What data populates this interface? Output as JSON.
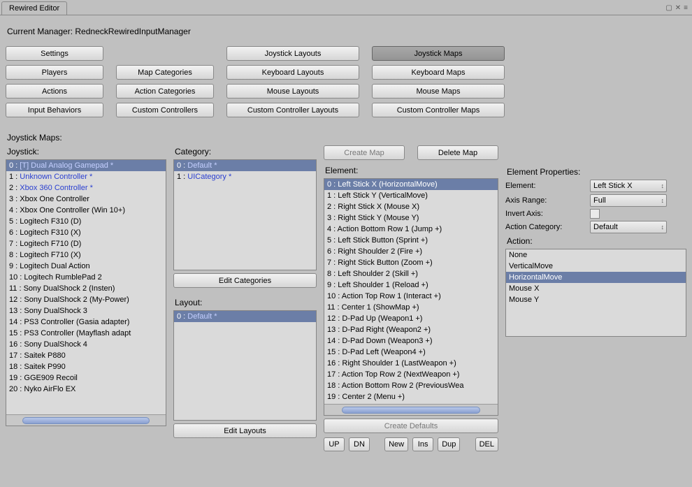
{
  "window": {
    "title": "Rewired Editor"
  },
  "manager": {
    "label": "Current Manager:",
    "name": "RedneckRewiredInputManager"
  },
  "topNav": {
    "row1": [
      "Settings",
      "",
      "Joystick Layouts",
      "Joystick Maps"
    ],
    "row2": [
      "Players",
      "Map Categories",
      "Keyboard Layouts",
      "Keyboard Maps"
    ],
    "row3": [
      "Actions",
      "Action Categories",
      "Mouse Layouts",
      "Mouse Maps"
    ],
    "row4": [
      "Input Behaviors",
      "Custom Controllers",
      "Custom Controller Layouts",
      "Custom Controller Maps"
    ],
    "active": "Joystick Maps"
  },
  "sectionTitles": {
    "joystickMaps": "Joystick Maps:",
    "joystick": "Joystick:",
    "category": "Category:",
    "layout": "Layout:",
    "element": "Element:",
    "elementProps": "Element Properties:"
  },
  "joysticks": [
    {
      "idx": 0,
      "label": "[T] Dual Analog Gamepad *",
      "link": true,
      "selected": true
    },
    {
      "idx": 1,
      "label": "Unknown Controller *",
      "link": true
    },
    {
      "idx": 2,
      "label": "Xbox 360 Controller *",
      "link": true
    },
    {
      "idx": 3,
      "label": "Xbox One Controller"
    },
    {
      "idx": 4,
      "label": "Xbox One Controller (Win 10+)"
    },
    {
      "idx": 5,
      "label": "Logitech F310 (D)"
    },
    {
      "idx": 6,
      "label": "Logitech F310 (X)"
    },
    {
      "idx": 7,
      "label": "Logitech F710 (D)"
    },
    {
      "idx": 8,
      "label": "Logitech F710 (X)"
    },
    {
      "idx": 9,
      "label": "Logitech Dual Action"
    },
    {
      "idx": 10,
      "label": "Logitech RumblePad 2"
    },
    {
      "idx": 11,
      "label": "Sony DualShock 2 (Insten)"
    },
    {
      "idx": 12,
      "label": "Sony DualShock 2 (My-Power)"
    },
    {
      "idx": 13,
      "label": "Sony DualShock 3"
    },
    {
      "idx": 14,
      "label": "PS3 Controller (Gasia adapter)"
    },
    {
      "idx": 15,
      "label": "PS3 Controller (Mayflash adapt"
    },
    {
      "idx": 16,
      "label": "Sony DualShock 4"
    },
    {
      "idx": 17,
      "label": "Saitek P880"
    },
    {
      "idx": 18,
      "label": "Saitek P990"
    },
    {
      "idx": 19,
      "label": "GGE909 Recoil"
    },
    {
      "idx": 20,
      "label": "Nyko AirFlo EX"
    }
  ],
  "categories": [
    {
      "idx": 0,
      "label": "Default *",
      "link": true,
      "selected": true
    },
    {
      "idx": 1,
      "label": "UICategory *",
      "link": true
    }
  ],
  "layouts": [
    {
      "idx": 0,
      "label": "Default *",
      "link": true,
      "selected": true
    }
  ],
  "mapButtons": {
    "create": "Create Map",
    "delete": "Delete Map"
  },
  "catButtons": {
    "edit": "Edit Categories"
  },
  "layoutButtons": {
    "edit": "Edit Layouts"
  },
  "defaultsButton": "Create Defaults",
  "elements": [
    {
      "idx": 0,
      "label": "Left Stick X  (HorizontalMove)",
      "selected": true
    },
    {
      "idx": 1,
      "label": "Left Stick Y  (VerticalMove)"
    },
    {
      "idx": 2,
      "label": "Right Stick X  (Mouse X)"
    },
    {
      "idx": 3,
      "label": "Right Stick Y  (Mouse Y)"
    },
    {
      "idx": 4,
      "label": "Action Bottom Row 1  (Jump +)"
    },
    {
      "idx": 5,
      "label": "Left Stick Button  (Sprint +)"
    },
    {
      "idx": 6,
      "label": "Right Shoulder 2  (Fire +)"
    },
    {
      "idx": 7,
      "label": "Right Stick Button  (Zoom +)"
    },
    {
      "idx": 8,
      "label": "Left Shoulder 2  (Skill +)"
    },
    {
      "idx": 9,
      "label": "Left Shoulder 1  (Reload +)"
    },
    {
      "idx": 10,
      "label": "Action Top Row 1  (Interact +)"
    },
    {
      "idx": 11,
      "label": "Center 1  (ShowMap +)"
    },
    {
      "idx": 12,
      "label": "D-Pad Up  (Weapon1 +)"
    },
    {
      "idx": 13,
      "label": "D-Pad Right  (Weapon2 +)"
    },
    {
      "idx": 14,
      "label": "D-Pad Down  (Weapon3 +)"
    },
    {
      "idx": 15,
      "label": "D-Pad Left  (Weapon4 +)"
    },
    {
      "idx": 16,
      "label": "Right Shoulder 1  (LastWeapon +)"
    },
    {
      "idx": 17,
      "label": "Action Top Row 2  (NextWeapon +)"
    },
    {
      "idx": 18,
      "label": "Action Bottom Row 2  (PreviousWea"
    },
    {
      "idx": 19,
      "label": "Center 2  (Menu +)"
    }
  ],
  "elementButtons": {
    "up": "UP",
    "dn": "DN",
    "new": "New",
    "ins": "Ins",
    "dup": "Dup",
    "del": "DEL"
  },
  "props": {
    "elementLabel": "Element:",
    "elementValue": "Left Stick X",
    "axisRangeLabel": "Axis Range:",
    "axisRangeValue": "Full",
    "invertAxisLabel": "Invert Axis:",
    "invertAxisValue": false,
    "actionCatLabel": "Action Category:",
    "actionCatValue": "Default",
    "actionLabel": "Action:"
  },
  "actions": [
    {
      "label": "None"
    },
    {
      "label": "VerticalMove"
    },
    {
      "label": "HorizontalMove",
      "selected": true
    },
    {
      "label": "Mouse X"
    },
    {
      "label": "Mouse Y"
    }
  ]
}
